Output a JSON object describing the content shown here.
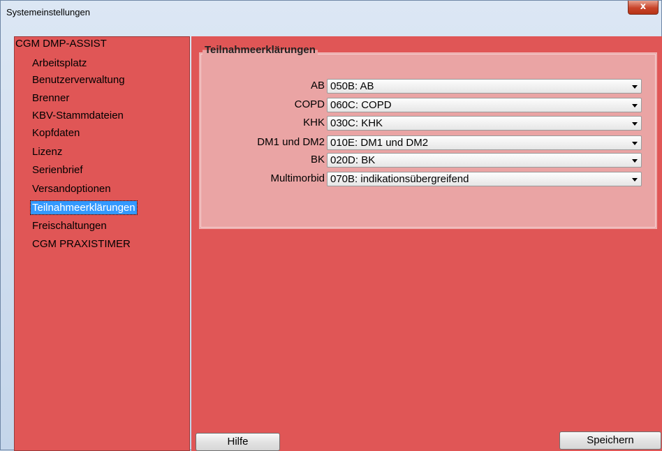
{
  "window": {
    "title": "Systemeinstellungen",
    "close_label": "x"
  },
  "sidebar": {
    "root": "CGM DMP-ASSIST",
    "items": [
      {
        "label": "Arbeitsplatz"
      },
      {
        "label": "Benutzerverwaltung"
      },
      {
        "label": "Brenner"
      },
      {
        "label": "KBV-Stammdateien"
      },
      {
        "label": "Kopfdaten"
      },
      {
        "label": "Lizenz"
      },
      {
        "label": "Serienbrief"
      },
      {
        "label": "Versandoptionen"
      },
      {
        "label": "Teilnahmeerklärungen",
        "selected": true
      },
      {
        "label": "Freischaltungen"
      },
      {
        "label": "CGM PRAXISTIMER"
      }
    ]
  },
  "group": {
    "title": "Teilnahmeerklärungen",
    "rows": [
      {
        "label": "AB",
        "value": "050B: AB"
      },
      {
        "label": "COPD",
        "value": "060C: COPD"
      },
      {
        "label": "KHK",
        "value": "030C: KHK"
      },
      {
        "label": "DM1 und DM2",
        "value": "010E: DM1 und DM2"
      },
      {
        "label": "BK",
        "value": "020D: BK"
      },
      {
        "label": "Multimorbid",
        "value": "070B: indikationsübergreifend"
      }
    ]
  },
  "buttons": {
    "help": "Hilfe",
    "save": "Speichern"
  },
  "colors": {
    "panel": "#e05656",
    "group": "#eaa4a4",
    "selection": "#3399ff"
  }
}
